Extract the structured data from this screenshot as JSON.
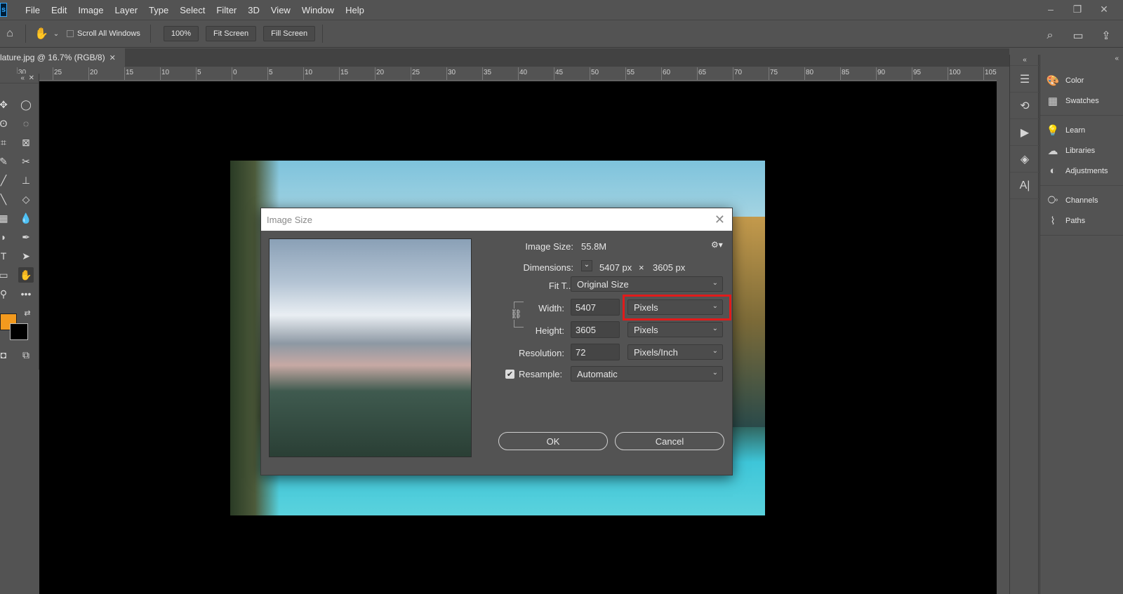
{
  "menu": [
    "File",
    "Edit",
    "Image",
    "Layer",
    "Type",
    "Select",
    "Filter",
    "3D",
    "View",
    "Window",
    "Help"
  ],
  "app": {
    "logo": "s"
  },
  "window_controls": {
    "minimize": "–",
    "restore": "❐",
    "close": "✕"
  },
  "options_bar": {
    "scroll_all_windows": "Scroll All Windows",
    "zoom_button": "100%",
    "fit_screen": "Fit Screen",
    "fill_screen": "Fill Screen"
  },
  "document_tab": {
    "title": "lature.jpg @ 16.7% (RGB/8)",
    "close": "✕"
  },
  "ruler_ticks": [
    "30",
    "25",
    "20",
    "15",
    "10",
    "5",
    "0",
    "5",
    "10",
    "15",
    "20",
    "25",
    "30",
    "35",
    "40",
    "45",
    "50",
    "55",
    "60",
    "65",
    "70",
    "75",
    "80",
    "85",
    "90",
    "95",
    "100",
    "105"
  ],
  "panels": [
    {
      "label": "Color",
      "icon": "color-palette-icon"
    },
    {
      "label": "Swatches",
      "icon": "swatches-grid-icon"
    },
    {
      "label": "Learn",
      "icon": "lightbulb-icon"
    },
    {
      "label": "Libraries",
      "icon": "cloud-libraries-icon"
    },
    {
      "label": "Adjustments",
      "icon": "adjustments-circle-icon"
    },
    {
      "label": "Channels",
      "icon": "channels-icon"
    },
    {
      "label": "Paths",
      "icon": "paths-icon"
    }
  ],
  "colors": {
    "foreground": "#f39a1e",
    "background": "#000000",
    "highlight": "#e11b1b"
  },
  "dialog": {
    "title": "Image Size",
    "close": "✕",
    "image_size_label": "Image Size:",
    "image_size_value": "55.8M",
    "dimensions_label": "Dimensions:",
    "dimensions_width": "5407 px",
    "dimensions_times": "×",
    "dimensions_height": "3605 px",
    "fit_to_label": "Fit T...",
    "fit_to_value": "Original Size",
    "width_label": "Width:",
    "width_value": "5407",
    "width_unit": "Pixels",
    "height_label": "Height:",
    "height_value": "3605",
    "height_unit": "Pixels",
    "resolution_label": "Resolution:",
    "resolution_value": "72",
    "resolution_unit": "Pixels/Inch",
    "resample_label": "Resample:",
    "resample_value": "Automatic",
    "ok": "OK",
    "cancel": "Cancel"
  }
}
